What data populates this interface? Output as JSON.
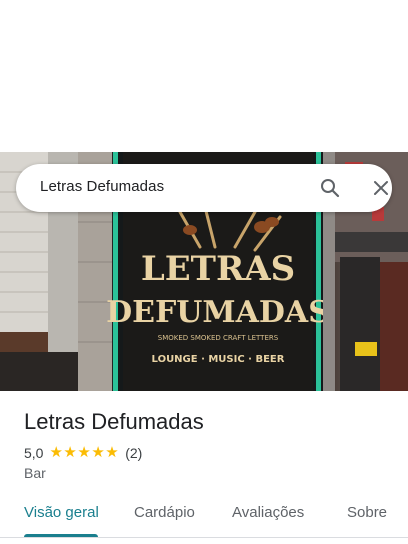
{
  "search": {
    "query": "Letras Defumadas"
  },
  "place": {
    "name": "Letras Defumadas",
    "rating": "5,0",
    "stars": 5,
    "review_count": "(2)",
    "category": "Bar"
  },
  "photo_sign": {
    "line1": "LETRAS",
    "line2": "DEFUMADAS",
    "tagline": "SMOKED SMOKED CRAFT LETTERS",
    "subline": "LOUNGE · MUSIC · BEER"
  },
  "tabs": [
    {
      "label": "Visão geral",
      "active": true
    },
    {
      "label": "Cardápio",
      "active": false
    },
    {
      "label": "Avaliações",
      "active": false
    },
    {
      "label": "Sobre",
      "active": false
    }
  ],
  "colors": {
    "accent": "#1a7f8e",
    "star": "#fbbc04",
    "neon": "#2fe0b0"
  }
}
